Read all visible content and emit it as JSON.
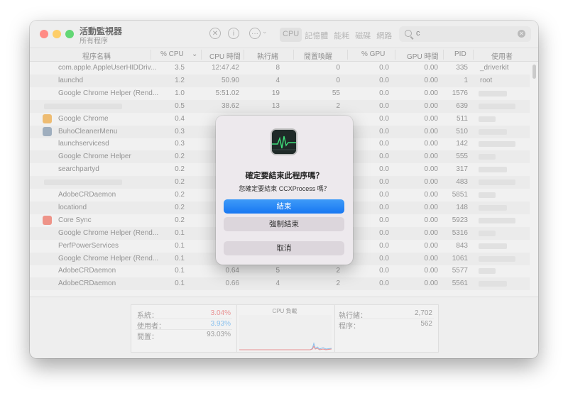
{
  "window": {
    "title": "活動監視器",
    "subtitle": "所有程序",
    "toolbar_icons": [
      "close-circle-icon",
      "info-icon",
      "ellipsis-icon",
      "chevron-down-icon"
    ],
    "tabs": [
      {
        "label": "CPU",
        "active": true
      },
      {
        "label": "記憶體",
        "active": false
      },
      {
        "label": "能耗",
        "active": false
      },
      {
        "label": "磁碟",
        "active": false
      },
      {
        "label": "網路",
        "active": false
      }
    ],
    "search": {
      "value": "c"
    }
  },
  "table": {
    "columns": [
      "程序名稱",
      "% CPU",
      "CPU 時間",
      "執行緒",
      "閒置喚醒",
      "% GPU",
      "GPU 時間",
      "PID",
      "使用者"
    ],
    "sorted_indicator": "⌄",
    "rows": [
      {
        "name": "com.apple.AppleUserHIDDriv...",
        "cpu": "3.5",
        "cputime": "12:47.42",
        "threads": "8",
        "idle": "0",
        "gpu": "0.0",
        "gputime": "0.00",
        "pid": "335",
        "user": "_driverkit"
      },
      {
        "name": "launchd",
        "cpu": "1.2",
        "cputime": "50.90",
        "threads": "4",
        "idle": "0",
        "gpu": "0.0",
        "gputime": "0.00",
        "pid": "1",
        "user": "root"
      },
      {
        "name": "Google Chrome Helper (Rend...",
        "cpu": "1.0",
        "cputime": "5:51.02",
        "threads": "19",
        "idle": "55",
        "gpu": "0.0",
        "gputime": "0.00",
        "pid": "1576",
        "user": ""
      },
      {
        "name": "",
        "cpu": "0.5",
        "cputime": "38.62",
        "threads": "13",
        "idle": "2",
        "gpu": "0.0",
        "gputime": "0.00",
        "pid": "639",
        "user": ""
      },
      {
        "name": "Google Chrome",
        "cpu": "0.4",
        "cputime": "",
        "threads": "",
        "idle": "",
        "gpu": "0.0",
        "gputime": "0.00",
        "pid": "511",
        "user": ""
      },
      {
        "name": "BuhoCleanerMenu",
        "cpu": "0.3",
        "cputime": "",
        "threads": "",
        "idle": "",
        "gpu": "0.0",
        "gputime": "0.00",
        "pid": "510",
        "user": ""
      },
      {
        "name": "launchservicesd",
        "cpu": "0.3",
        "cputime": "",
        "threads": "",
        "idle": "",
        "gpu": "0.0",
        "gputime": "0.00",
        "pid": "142",
        "user": ""
      },
      {
        "name": "Google Chrome Helper",
        "cpu": "0.2",
        "cputime": "",
        "threads": "",
        "idle": "",
        "gpu": "0.0",
        "gputime": "0.00",
        "pid": "555",
        "user": ""
      },
      {
        "name": "searchpartyd",
        "cpu": "0.2",
        "cputime": "",
        "threads": "",
        "idle": "",
        "gpu": "0.0",
        "gputime": "0.00",
        "pid": "317",
        "user": ""
      },
      {
        "name": "",
        "cpu": "0.2",
        "cputime": "",
        "threads": "",
        "idle": "",
        "gpu": "0.0",
        "gputime": "0.00",
        "pid": "483",
        "user": ""
      },
      {
        "name": "AdobeCRDaemon",
        "cpu": "0.2",
        "cputime": "",
        "threads": "",
        "idle": "",
        "gpu": "0.0",
        "gputime": "0.00",
        "pid": "5851",
        "user": ""
      },
      {
        "name": "locationd",
        "cpu": "0.2",
        "cputime": "",
        "threads": "",
        "idle": "",
        "gpu": "0.0",
        "gputime": "0.00",
        "pid": "148",
        "user": ""
      },
      {
        "name": "Core Sync",
        "cpu": "0.2",
        "cputime": "",
        "threads": "",
        "idle": "",
        "gpu": "0.0",
        "gputime": "0.00",
        "pid": "5923",
        "user": ""
      },
      {
        "name": "Google Chrome Helper (Rend...",
        "cpu": "0.1",
        "cputime": "",
        "threads": "",
        "idle": "",
        "gpu": "0.0",
        "gputime": "0.00",
        "pid": "5316",
        "user": ""
      },
      {
        "name": "PerfPowerServices",
        "cpu": "0.1",
        "cputime": "",
        "threads": "",
        "idle": "",
        "gpu": "0.0",
        "gputime": "0.00",
        "pid": "843",
        "user": ""
      },
      {
        "name": "Google Chrome Helper (Rend...",
        "cpu": "0.1",
        "cputime": "",
        "threads": "",
        "idle": "",
        "gpu": "0.0",
        "gputime": "0.00",
        "pid": "1061",
        "user": ""
      },
      {
        "name": "AdobeCRDaemon",
        "cpu": "0.1",
        "cputime": "0.64",
        "threads": "5",
        "idle": "2",
        "gpu": "0.0",
        "gputime": "0.00",
        "pid": "5577",
        "user": ""
      },
      {
        "name": "AdobeCRDaemon",
        "cpu": "0.1",
        "cputime": "0.66",
        "threads": "4",
        "idle": "2",
        "gpu": "0.0",
        "gputime": "0.00",
        "pid": "5561",
        "user": ""
      }
    ]
  },
  "summary": {
    "left": [
      {
        "label": "系統：",
        "value": "3.04%",
        "color": "#e0686a"
      },
      {
        "label": "使用者：",
        "value": "3.93%",
        "color": "#5aa8e8"
      },
      {
        "label": "閒置：",
        "value": "93.03%",
        "color": "#555555"
      }
    ],
    "chart_title": "CPU 負載",
    "right": [
      {
        "label": "執行緒：",
        "value": "2,702"
      },
      {
        "label": "程序：",
        "value": "562"
      }
    ]
  },
  "dialog": {
    "icon": "activity-monitor-icon",
    "title": "確定要結束此程序嗎？",
    "message": "您確定要結束 CCXProcess 嗎？",
    "buttons": {
      "quit": "結束",
      "force_quit": "強制結束",
      "cancel": "取消"
    },
    "accent": "#1f7ff5"
  }
}
